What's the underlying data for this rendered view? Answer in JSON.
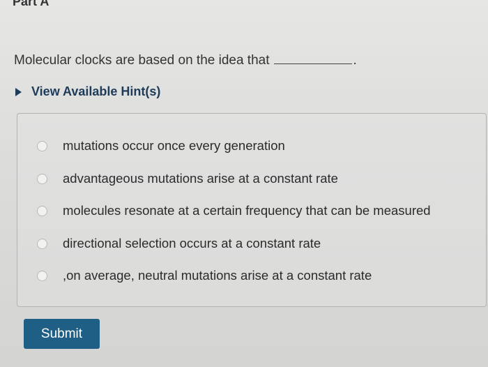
{
  "part": {
    "title": "Part A"
  },
  "question": {
    "text": "Molecular clocks are based on the idea that",
    "terminal": "."
  },
  "hints": {
    "label": "View Available Hint(s)",
    "icon": "triangle-right-icon"
  },
  "options": [
    {
      "label": "mutations occur once every generation",
      "selected": false
    },
    {
      "label": "advantageous mutations arise at a constant rate",
      "selected": false
    },
    {
      "label": "molecules resonate at a certain frequency that can be measured",
      "selected": false
    },
    {
      "label": "directional selection occurs at a constant rate",
      "selected": false
    },
    {
      "label": ",on average, neutral mutations arise at a constant rate",
      "selected": false
    }
  ],
  "actions": {
    "submit_label": "Submit"
  },
  "colors": {
    "accent": "#1f5f86",
    "hint_text": "#1e3b5a"
  }
}
